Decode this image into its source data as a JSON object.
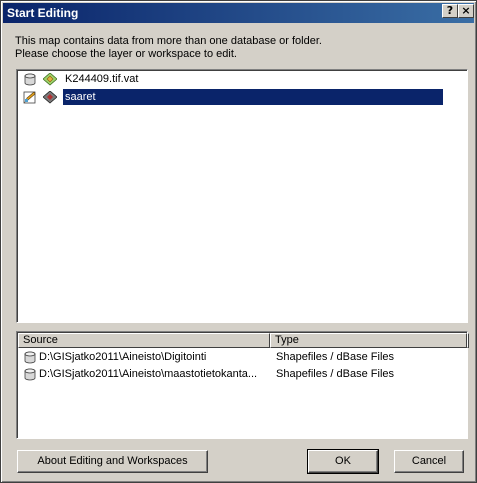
{
  "window": {
    "title": "Start Editing",
    "help_label": "?",
    "close_label": "×"
  },
  "message": {
    "line1": "This map contains data from more than one database or folder.",
    "line2": "Please choose the layer or workspace to edit."
  },
  "layers": [
    {
      "name": "K244409.tif.vat",
      "selected": false
    },
    {
      "name": "saaret",
      "selected": true
    }
  ],
  "sources": {
    "headers": {
      "source": "Source",
      "type": "Type"
    },
    "rows": [
      {
        "path": "D:\\GISjatko2011\\Aineisto\\Digitointi",
        "type": "Shapefiles / dBase Files"
      },
      {
        "path": "D:\\GISjatko2011\\Aineisto\\maastotietokanta...",
        "type": "Shapefiles / dBase Files"
      }
    ]
  },
  "buttons": {
    "about": "About Editing and Workspaces",
    "ok": "OK",
    "cancel": "Cancel"
  },
  "colors": {
    "titlebar": "#0a246a",
    "selection": "#0a246a",
    "dialog_bg": "#d4d0c8"
  }
}
